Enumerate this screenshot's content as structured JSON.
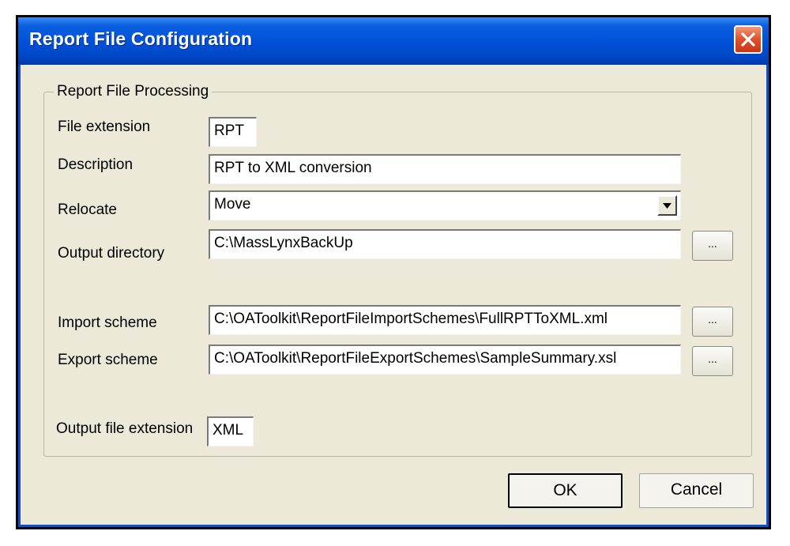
{
  "window": {
    "title": "Report File Configuration",
    "close_glyph": "close-icon"
  },
  "group": {
    "title": "Report File Processing",
    "file_extension": {
      "label": "File extension",
      "value": "RPT"
    },
    "description": {
      "label": "Description",
      "value": "RPT to XML conversion"
    },
    "relocate": {
      "label": "Relocate",
      "value": "Move"
    },
    "output_directory": {
      "label": "Output directory",
      "value": "C:\\MassLynxBackUp",
      "browse_label": "..."
    },
    "import_scheme": {
      "label": "Import scheme",
      "value": "C:\\OAToolkit\\ReportFileImportSchemes\\FullRPTToXML.xml",
      "browse_label": "..."
    },
    "export_scheme": {
      "label": "Export scheme",
      "value": "C:\\OAToolkit\\ReportFileExportSchemes\\SampleSummary.xsl",
      "browse_label": "..."
    },
    "output_file_extension": {
      "label": "Output file extension",
      "value": "XML"
    }
  },
  "buttons": {
    "ok": "OK",
    "cancel": "Cancel"
  },
  "colors": {
    "titlebar": "#0050d8",
    "close_button": "#e0502a",
    "dialog_bg": "#ece9d8"
  }
}
